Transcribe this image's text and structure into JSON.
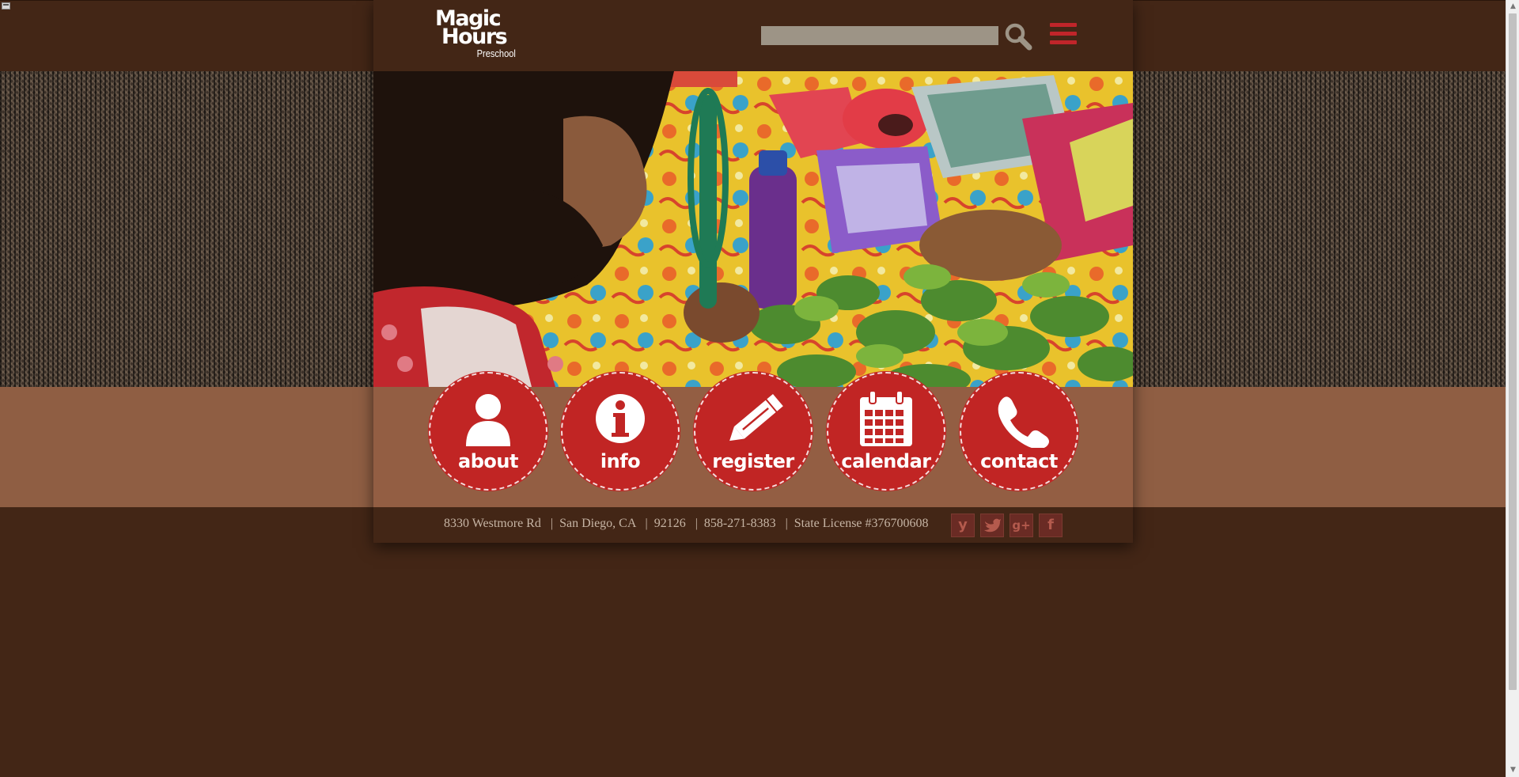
{
  "header": {
    "logo": {
      "line1": "Magic",
      "line2": "Hours",
      "line3": "Preschool"
    },
    "search": {
      "placeholder": "",
      "value": ""
    },
    "search_icon": "search-icon",
    "menu_icon": "hamburger-menu-icon"
  },
  "hero": {
    "image_description_icon": "hero-photo"
  },
  "nav": {
    "items": [
      {
        "label": "about",
        "icon": "person-icon"
      },
      {
        "label": "info",
        "icon": "info-icon"
      },
      {
        "label": "register",
        "icon": "pencil-icon"
      },
      {
        "label": "calendar",
        "icon": "calendar-icon"
      },
      {
        "label": "contact",
        "icon": "phone-icon"
      }
    ]
  },
  "footer": {
    "address": "8330 Westmore Rd",
    "city": "San Diego, CA",
    "zip": "92126",
    "phone": "858-271-8383",
    "license": "State License #376700608",
    "social": [
      {
        "glyph": "y",
        "icon": "yelp-icon"
      },
      {
        "glyph": "t",
        "icon": "twitter-icon"
      },
      {
        "glyph": "g+",
        "icon": "google-plus-icon"
      },
      {
        "glyph": "f",
        "icon": "facebook-icon"
      }
    ]
  },
  "colors": {
    "background_dark": "#432616",
    "band_tan": "#935e43",
    "accent_red": "#c12524",
    "footer_text": "#c6b4a4"
  }
}
